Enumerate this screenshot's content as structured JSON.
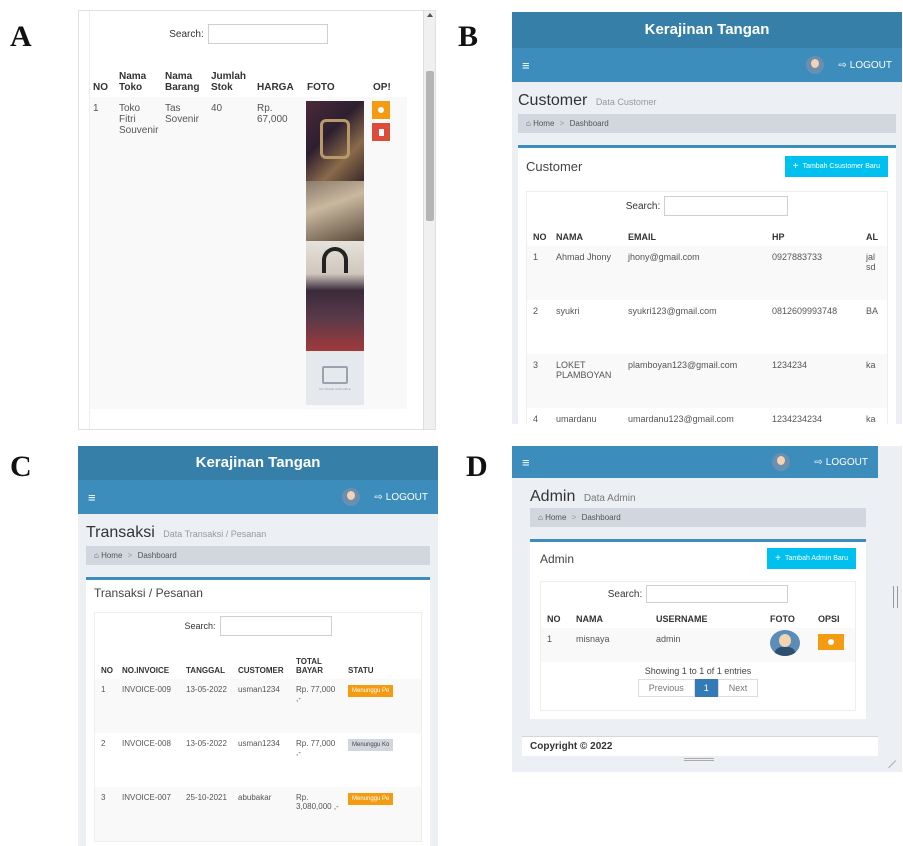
{
  "letters": {
    "a": "A",
    "b": "B",
    "c": "C",
    "d": "D"
  },
  "colors": {
    "primary": "#3c8dbc",
    "info": "#00c0ef",
    "warning": "#f39c12",
    "danger": "#dd4b39",
    "crumb": "#d2d6de"
  },
  "common": {
    "brand": "Kerajinan Tangan",
    "logout": "LOGOUT",
    "search_label": "Search:",
    "home": "Home",
    "sep": ">",
    "dashboard": "Dashboard"
  },
  "panel_a": {
    "headers": {
      "no": "NO",
      "toko": "Nama Toko",
      "barang": "Nama Barang",
      "stok": "Jumlah Stok",
      "harga": "HARGA",
      "foto": "FOTO",
      "opsi": "OP!"
    },
    "row": {
      "no": "1",
      "toko": "Toko Fitri Souvenir",
      "barang": "Tas Sovenir",
      "stok": "40",
      "harga": "Rp. 67,000"
    },
    "no_image_text": "NO IMAGE AVAILABLE"
  },
  "panel_b": {
    "page_title": "Customer",
    "page_subtitle": "Data Customer",
    "box_title": "Customer",
    "add_button": "Tambah Csustomer Baru",
    "headers": {
      "no": "NO",
      "nama": "NAMA",
      "email": "EMAIL",
      "hp": "HP",
      "alamat": "AL"
    },
    "rows": [
      {
        "no": "1",
        "nama": "Ahmad Jhony",
        "email": "jhony@gmail.com",
        "hp": "0927883733",
        "alamat": "jal sd"
      },
      {
        "no": "2",
        "nama": "syukri",
        "email": "syukri123@gmail.com",
        "hp": "0812609993748",
        "alamat": "BA"
      },
      {
        "no": "3",
        "nama": "LOKET PLAMBOYAN",
        "email": "plamboyan123@gmail.com",
        "hp": "1234234",
        "alamat": "ka"
      },
      {
        "no": "4",
        "nama": "umardanu",
        "email": "umardanu123@gmail.com",
        "hp": "1234234234",
        "alamat": "ka"
      }
    ]
  },
  "panel_c": {
    "page_title": "Transaksi",
    "page_subtitle": "Data Transaksi / Pesanan",
    "box_title": "Transaksi / Pesanan",
    "headers": {
      "no": "NO",
      "invoice": "NO.INVOICE",
      "tanggal": "TANGGAL",
      "customer": "CUSTOMER",
      "total": "TOTAL BAYAR",
      "status": "STATU"
    },
    "rows": [
      {
        "no": "1",
        "invoice": "INVOICE-009",
        "tanggal": "13-05-2022",
        "customer": "usman1234",
        "total": "Rp. 77,000 ,-",
        "status": "Menunggu Pe"
      },
      {
        "no": "2",
        "invoice": "INVOICE-008",
        "tanggal": "13-05-2022",
        "customer": "usman1234",
        "total": "Rp. 77,000 ,-",
        "status": "Menunggu Ko"
      },
      {
        "no": "3",
        "invoice": "INVOICE-007",
        "tanggal": "25-10-2021",
        "customer": "abubakar",
        "total": "Rp. 3,080,000 ,-",
        "status": "Menunggu Pe"
      }
    ]
  },
  "panel_d": {
    "page_title": "Admin",
    "page_subtitle": "Data Admin",
    "box_title": "Admin",
    "add_button": "Tambah Admin Baru",
    "headers": {
      "no": "NO",
      "nama": "NAMA",
      "username": "USERNAME",
      "foto": "FOTO",
      "opsi": "OPSI"
    },
    "row": {
      "no": "1",
      "nama": "misnaya",
      "username": "admin"
    },
    "showing": "Showing 1 to 1 of 1 entries",
    "pagination": {
      "previous": "Previous",
      "page": "1",
      "next": "Next"
    },
    "footer": "Copyright © 2022"
  }
}
